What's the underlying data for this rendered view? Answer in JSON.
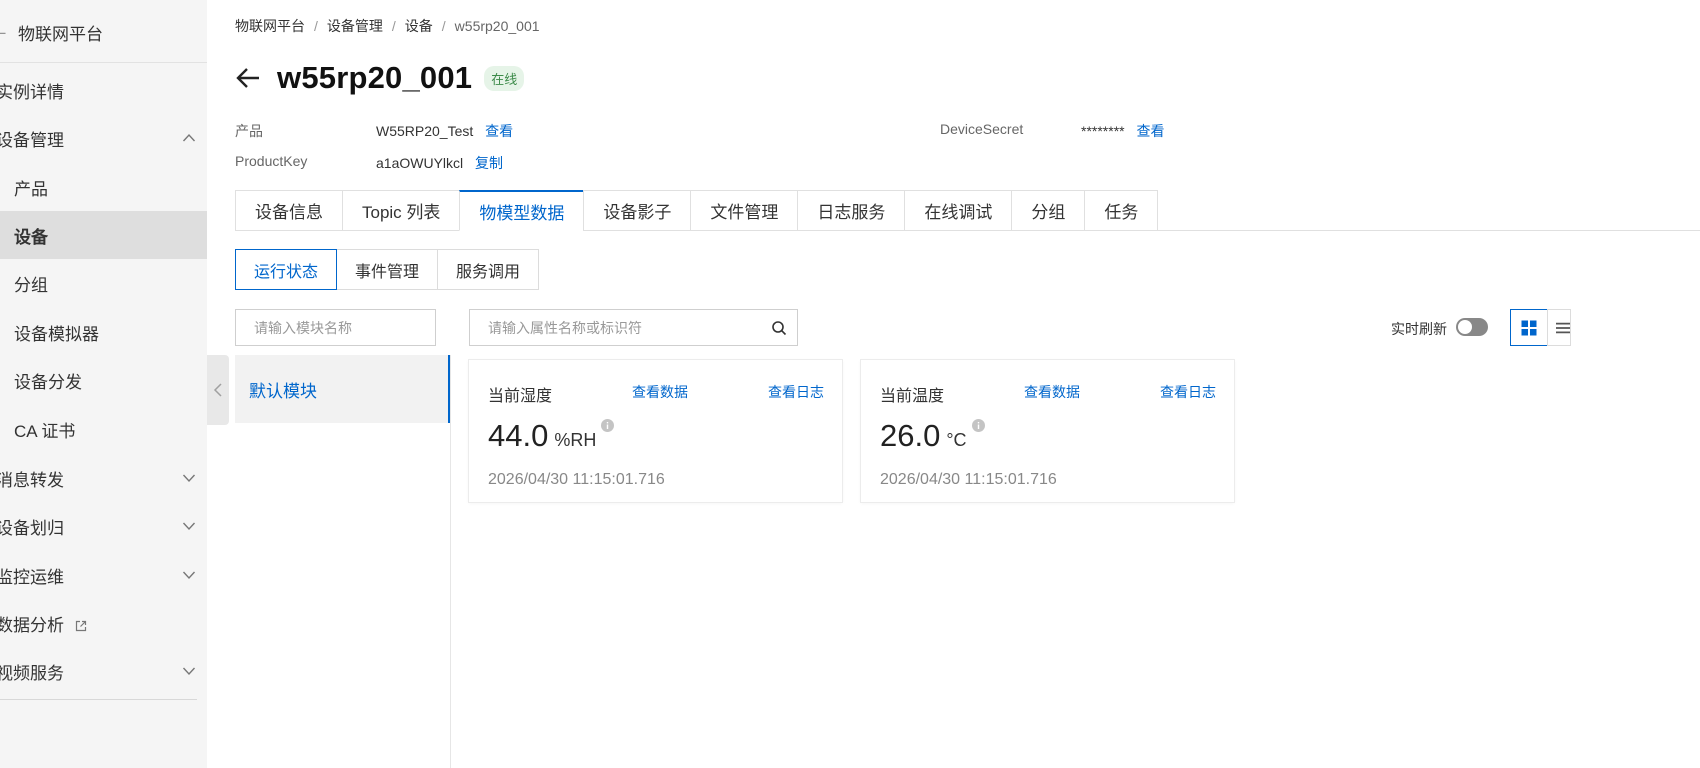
{
  "sidebar": {
    "header": {
      "back_glyph": "←",
      "title": "物联网平台"
    },
    "items": [
      {
        "label": "实例详情"
      },
      {
        "label": "设备管理"
      },
      {
        "label": "产品"
      },
      {
        "label": "设备"
      },
      {
        "label": "分组"
      },
      {
        "label": "设备模拟器"
      },
      {
        "label": "设备分发"
      },
      {
        "label": "CA 证书"
      },
      {
        "label": "消息转发"
      },
      {
        "label": "设备划归"
      },
      {
        "label": "监控运维"
      },
      {
        "label": "数据分析"
      },
      {
        "label": "视频服务"
      }
    ]
  },
  "breadcrumb": [
    "物联网平台",
    "设备管理",
    "设备",
    "w55rp20_001"
  ],
  "breadcrumb_sep": "/",
  "device": {
    "name": "w55rp20_001",
    "status": "在线",
    "product_label": "产品",
    "product_value": "W55RP20_Test",
    "product_link": "查看",
    "productkey_label": "ProductKey",
    "productkey_value": "a1aOWUYlkcl",
    "productkey_link": "复制",
    "secret_label": "DeviceSecret",
    "secret_value": "********",
    "secret_link": "查看"
  },
  "tabs": [
    "设备信息",
    "Topic 列表",
    "物模型数据",
    "设备影子",
    "文件管理",
    "日志服务",
    "在线调试",
    "分组",
    "任务"
  ],
  "active_tab": "物模型数据",
  "subtabs": [
    "运行状态",
    "事件管理",
    "服务调用"
  ],
  "module_search": {
    "placeholder": "请输入模块名称"
  },
  "module_list": [
    {
      "label": "默认模块"
    }
  ],
  "property_search": {
    "placeholder": "请输入属性名称或标识符"
  },
  "realtime_refresh": {
    "label": "实时刷新",
    "enabled": false
  },
  "cards": [
    {
      "name": "当前湿度",
      "view_data": "查看数据",
      "view_log": "查看日志",
      "value": "44.0",
      "unit": "%RH",
      "time": "2026/04/30 11:15:01.716"
    },
    {
      "name": "当前温度",
      "view_data": "查看数据",
      "view_log": "查看日志",
      "value": "26.0",
      "unit": "°C",
      "time": "2026/04/30 11:15:01.716"
    }
  ],
  "colors": {
    "accent": "#0066cc",
    "sidebar_bg": "#f5f5f5",
    "sidebar_active": "#dedede",
    "status_bg": "#e6f4e8",
    "status_text": "#3d8b4a"
  }
}
